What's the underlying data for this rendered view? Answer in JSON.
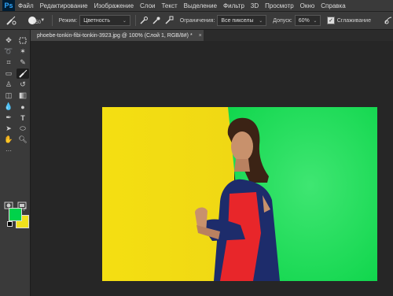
{
  "app": {
    "logo": "Ps"
  },
  "menu": [
    "Файл",
    "Редактирование",
    "Изображение",
    "Слои",
    "Текст",
    "Выделение",
    "Фильтр",
    "3D",
    "Просмотр",
    "Окно",
    "Справка"
  ],
  "options": {
    "brush_size": "150",
    "mode_label": "Режим:",
    "mode_value": "Цветность",
    "limits_label": "Ограничения:",
    "limits_value": "Все пикселы",
    "tolerance_label": "Допуск:",
    "tolerance_value": "60%",
    "antialias_label": "Сглаживание",
    "antialias_checked": true
  },
  "document": {
    "tab_title": "phoebe-tonkin-fibi-tonkin-3923.jpg @ 100% (Слой 1, RGB/8#) *",
    "close": "×"
  },
  "colors": {
    "foreground": "#00d24a",
    "background": "#f0e11c",
    "canvas_left": "#f2dc13",
    "canvas_right": "#12d84f"
  },
  "tools": [
    "move-tool-icon",
    "marquee-tool-icon",
    "lasso-tool-icon",
    "magic-wand-tool-icon",
    "crop-tool-icon",
    "eyedropper-tool-icon",
    "healing-brush-tool-icon",
    "color-replacement-tool-icon",
    "clone-stamp-tool-icon",
    "history-brush-tool-icon",
    "eraser-tool-icon",
    "gradient-tool-icon",
    "blur-tool-icon",
    "dodge-tool-icon",
    "pen-tool-icon",
    "type-tool-icon",
    "path-selection-tool-icon",
    "ellipse-tool-icon",
    "hand-tool-icon",
    "zoom-tool-icon"
  ]
}
